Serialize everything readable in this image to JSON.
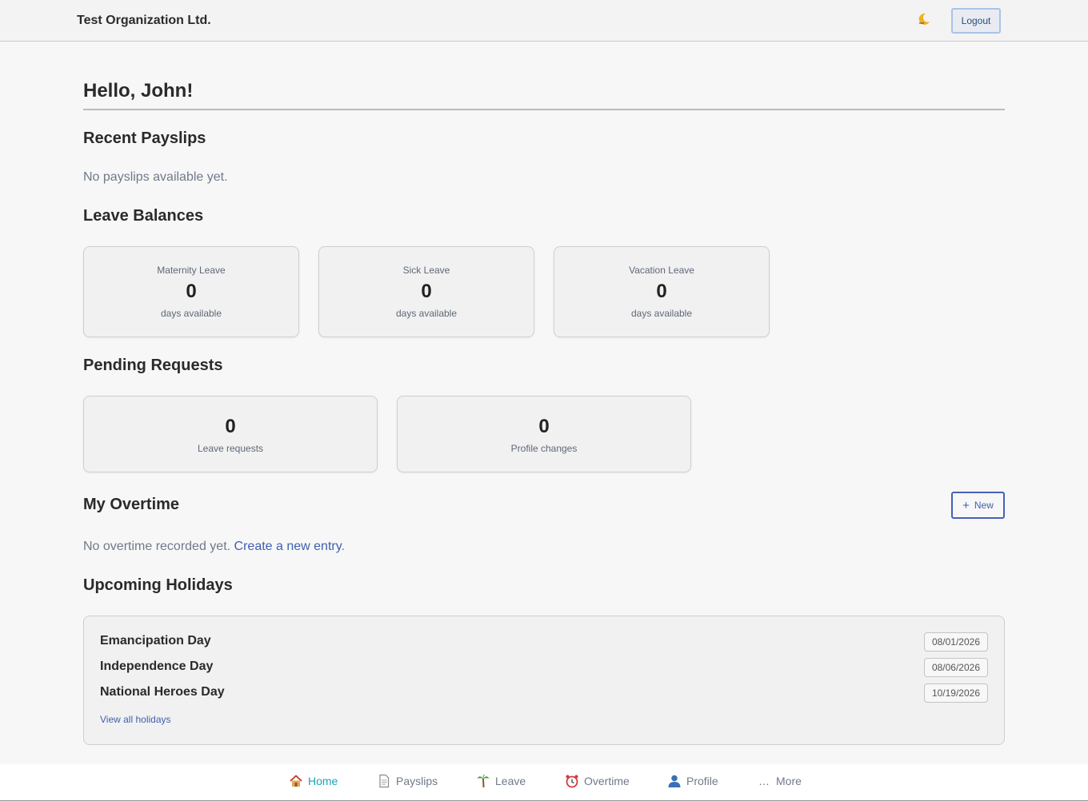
{
  "header": {
    "org_name": "Test Organization Ltd.",
    "theme_icon": "moon-icon",
    "logout_label": "Logout"
  },
  "greeting": "Hello, John!",
  "payslips": {
    "title": "Recent Payslips",
    "empty_text": "No payslips available yet."
  },
  "leave_balances": {
    "title": "Leave Balances",
    "items": [
      {
        "label": "Maternity Leave",
        "value": "0",
        "sub": "days available"
      },
      {
        "label": "Sick Leave",
        "value": "0",
        "sub": "days available"
      },
      {
        "label": "Vacation Leave",
        "value": "0",
        "sub": "days available"
      }
    ]
  },
  "pending_requests": {
    "title": "Pending Requests",
    "items": [
      {
        "value": "0",
        "label": "Leave requests"
      },
      {
        "value": "0",
        "label": "Profile changes"
      }
    ]
  },
  "overtime": {
    "title": "My Overtime",
    "new_label": "New",
    "empty_text": "No overtime recorded yet. ",
    "create_link": "Create a new entry",
    "period": "."
  },
  "holidays": {
    "title": "Upcoming Holidays",
    "items": [
      {
        "name": "Emancipation Day",
        "date": "08/01/2026"
      },
      {
        "name": "Independence Day",
        "date": "08/06/2026"
      },
      {
        "name": "National Heroes Day",
        "date": "10/19/2026"
      }
    ],
    "view_all": "View all holidays"
  },
  "bottom_nav": {
    "active_color": "#1aa3b5",
    "items": [
      {
        "label": "Home",
        "icon": "house-icon"
      },
      {
        "label": "Payslips",
        "icon": "document-icon"
      },
      {
        "label": "Leave",
        "icon": "palm-tree-icon"
      },
      {
        "label": "Overtime",
        "icon": "alarm-clock-icon"
      },
      {
        "label": "Profile",
        "icon": "person-icon"
      },
      {
        "label": "More",
        "icon": "ellipsis-icon"
      }
    ]
  }
}
